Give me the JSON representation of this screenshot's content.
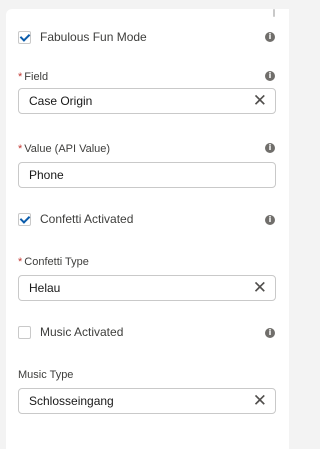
{
  "fabulous": {
    "label": "Fabulous Fun Mode",
    "checked": true
  },
  "field": {
    "required_mark": "*",
    "label": "Field",
    "value": "Case Origin"
  },
  "value_field": {
    "required_mark": "*",
    "label": "Value (API Value)",
    "value": "Phone"
  },
  "confetti": {
    "label": "Confetti Activated",
    "checked": true
  },
  "confetti_type": {
    "required_mark": "*",
    "label": "Confetti Type",
    "value": "Helau"
  },
  "music": {
    "label": "Music Activated",
    "checked": false
  },
  "music_type": {
    "label": "Music Type",
    "value": "Schlosseingang"
  },
  "icons": {
    "info": "i",
    "clear": "✕"
  },
  "colors": {
    "accent": "#0b5cab",
    "required": "#c23934",
    "info": "#706e6b"
  }
}
